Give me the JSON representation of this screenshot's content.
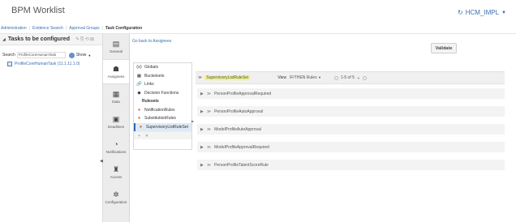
{
  "app": {
    "title": "BPM Worklist",
    "user": "HCM_IMPL"
  },
  "icons": {
    "user": "user-icon",
    "caret": "chevron-down-icon"
  },
  "nav": [
    {
      "label": "Administration",
      "active": false
    },
    {
      "label": "Evidence Search",
      "active": false
    },
    {
      "label": "Approval Groups",
      "active": false
    },
    {
      "label": "Task Configuration",
      "active": true
    }
  ],
  "left_panel": {
    "title": "Tasks to be configured",
    "search_label": "Search",
    "search_value": "ProfileCoreHumanTask",
    "show_label": "Show",
    "tree_item": "ProfileCoreHumanTask (11.1.11.1.0)"
  },
  "vtabs": [
    {
      "label": "General",
      "icon": "document-icon"
    },
    {
      "label": "Assignees",
      "icon": "assignees-icon"
    },
    {
      "label": "Data",
      "icon": "data-icon"
    },
    {
      "label": "Deadlines",
      "icon": "calendar-icon"
    },
    {
      "label": "Notifications",
      "icon": "notifications-icon"
    },
    {
      "label": "Access",
      "icon": "access-icon"
    },
    {
      "label": "Configuration",
      "icon": "gear-icon"
    }
  ],
  "back_link": "Go back to Assignees",
  "sidebar": {
    "items": [
      {
        "label": "Globals",
        "icon": "(x)"
      },
      {
        "label": "Bucketsets",
        "icon": "▦"
      },
      {
        "label": "Links",
        "icon": "🔗"
      },
      {
        "label": "Decision Functions",
        "icon": "◆"
      }
    ],
    "rulesets_heading": "Rulesets",
    "rulesets": [
      {
        "label": "NotificationRules",
        "selected": false
      },
      {
        "label": "SubstitutionRules",
        "selected": false
      },
      {
        "label": "SupervisoryListRuleSet",
        "selected": true
      }
    ],
    "add_icon": "+",
    "remove_icon": "✕"
  },
  "validate_label": "Validate",
  "ruleset_header": {
    "name": "SupervisoryListRuleSet",
    "view_label": "View",
    "view_value": "IF/THEN Rules",
    "pager": "1-5 of 5"
  },
  "rules": [
    {
      "name": "PersonProfileApprovalRequired"
    },
    {
      "name": "PersonProfileAutoApproval"
    },
    {
      "name": "ModelProfileAutoApproval"
    },
    {
      "name": "ModelProfileApprovalRequired"
    },
    {
      "name": "PersonProfileTalentScoreRule"
    }
  ]
}
